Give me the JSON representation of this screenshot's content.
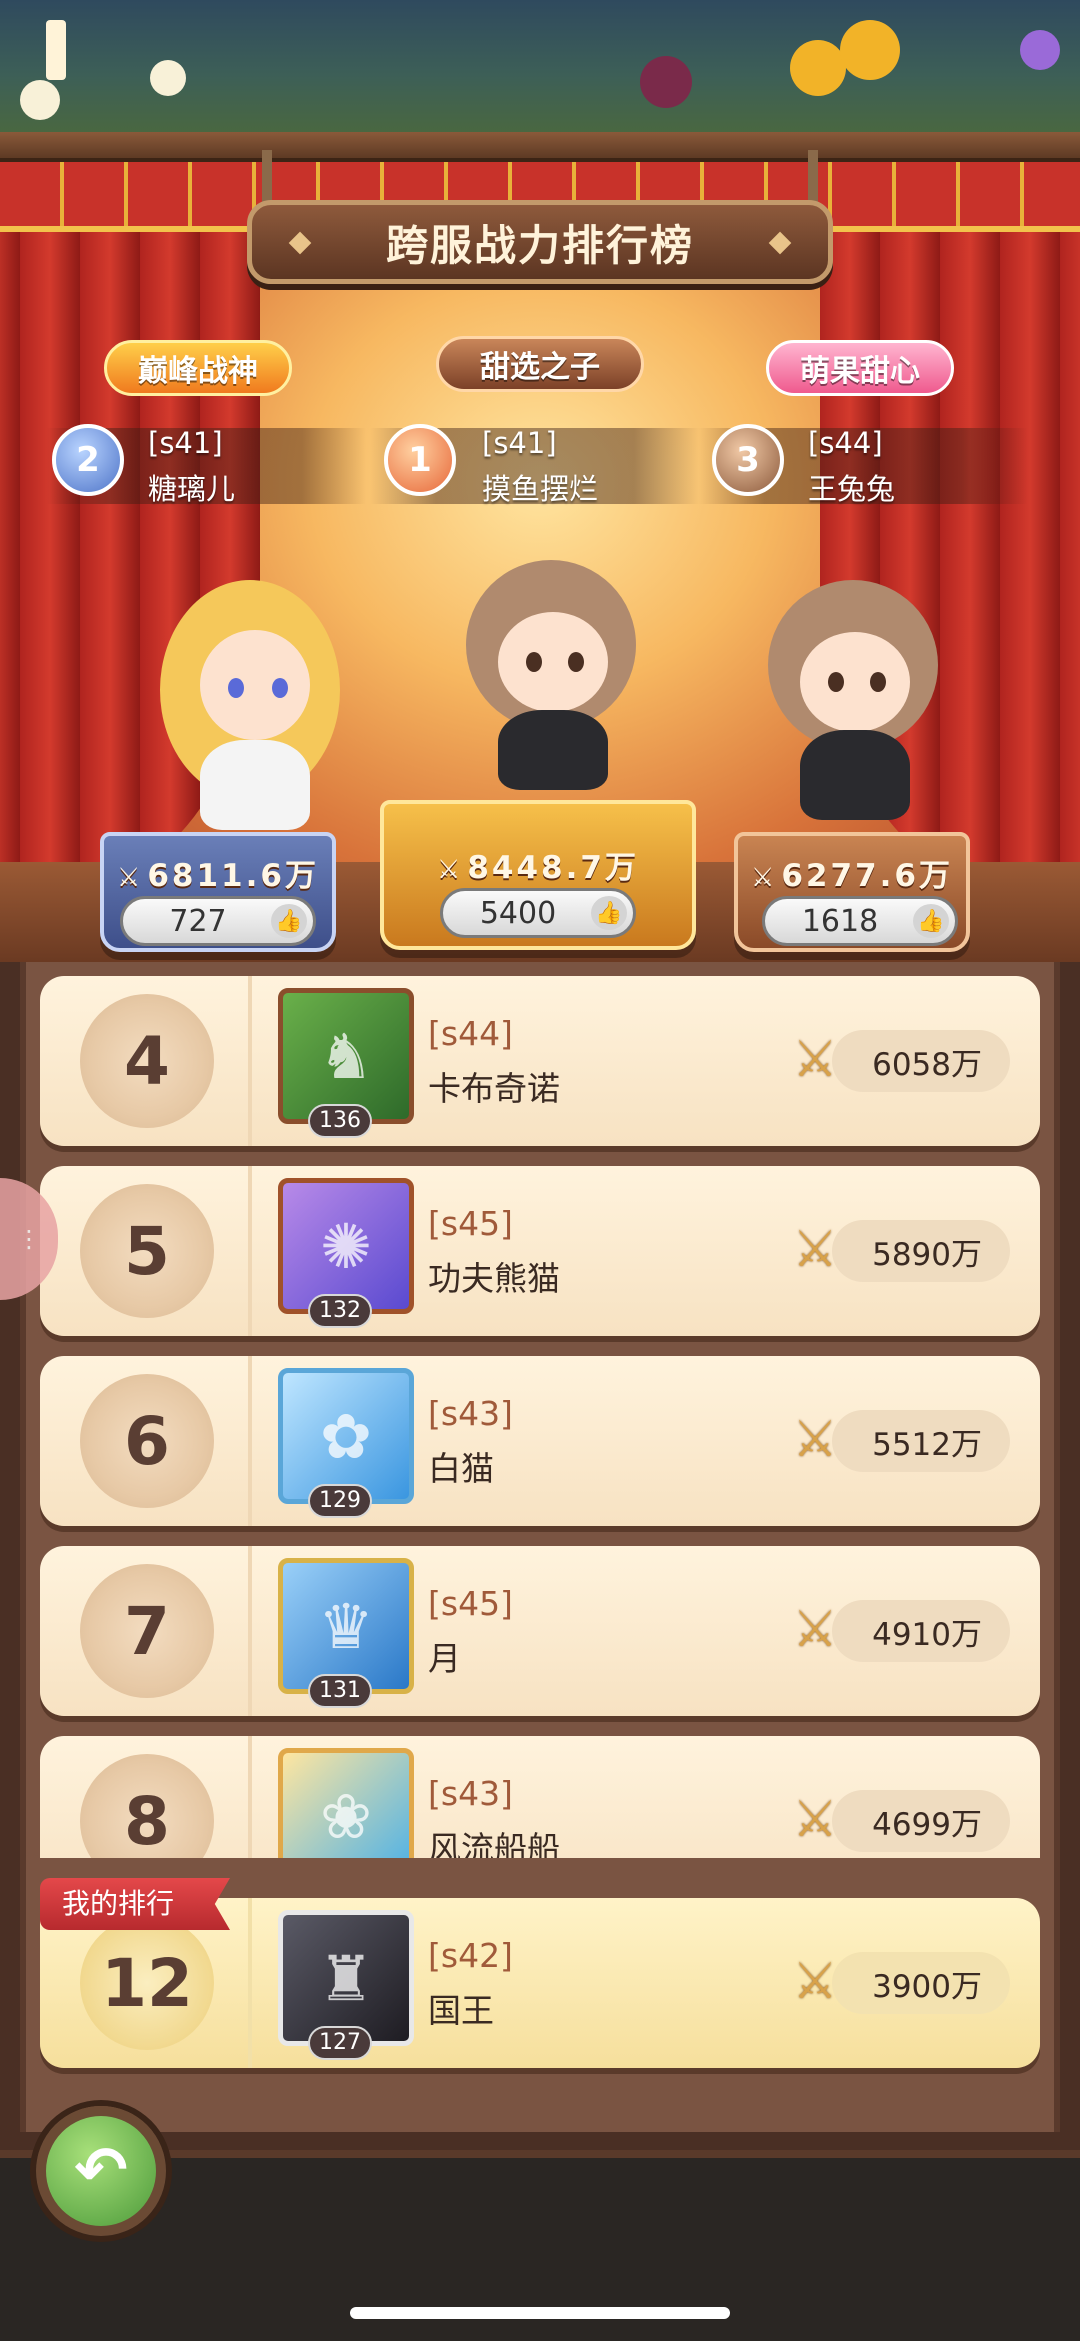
{
  "title": "跨服战力排行榜",
  "badges": {
    "left": "巅峰战神",
    "center": "甜选之子",
    "right": "萌果甜心"
  },
  "top3": [
    {
      "rank": "2",
      "server": "[s41]",
      "name": "糖璃儿",
      "power": "6811.6万",
      "likes": "727"
    },
    {
      "rank": "1",
      "server": "[s41]",
      "name": "摸鱼摆烂",
      "power": "8448.7万",
      "likes": "5400"
    },
    {
      "rank": "3",
      "server": "[s44]",
      "name": "王兔兔",
      "power": "6277.6万",
      "likes": "1618"
    }
  ],
  "list": [
    {
      "rank": "4",
      "server": "[s44]",
      "name": "卡布奇诺",
      "level": "136",
      "power": "6058万",
      "avatar_color": "#4a8a3a",
      "avatar_icon": "armored-hero-icon"
    },
    {
      "rank": "5",
      "server": "[s45]",
      "name": "功夫熊猫",
      "level": "132",
      "power": "5890万",
      "avatar_color": "#6c5bd0",
      "avatar_icon": "fire-spirit-icon"
    },
    {
      "rank": "6",
      "server": "[s43]",
      "name": "白猫",
      "level": "129",
      "power": "5512万",
      "avatar_color": "#4aa6e4",
      "avatar_icon": "white-hair-girl-icon"
    },
    {
      "rank": "7",
      "server": "[s45]",
      "name": "月",
      "level": "131",
      "power": "4910万",
      "avatar_color": "#3d8ad8",
      "avatar_icon": "crowned-girl-icon"
    },
    {
      "rank": "8",
      "server": "[s43]",
      "name": "风流船船",
      "level": "",
      "power": "4699万",
      "avatar_color": "#4ab0e8",
      "avatar_icon": "blonde-girl-icon"
    }
  ],
  "my_rank": {
    "tag": "我的排行",
    "rank": "12",
    "server": "[s42]",
    "name": "国王",
    "level": "127",
    "power": "3900万",
    "avatar_color": "#2e2a30",
    "avatar_icon": "hooded-knight-icon"
  },
  "icons": {
    "swords": "crossed-swords-icon",
    "thumb": "thumbs-up-icon",
    "back": "back-arrow-icon"
  }
}
